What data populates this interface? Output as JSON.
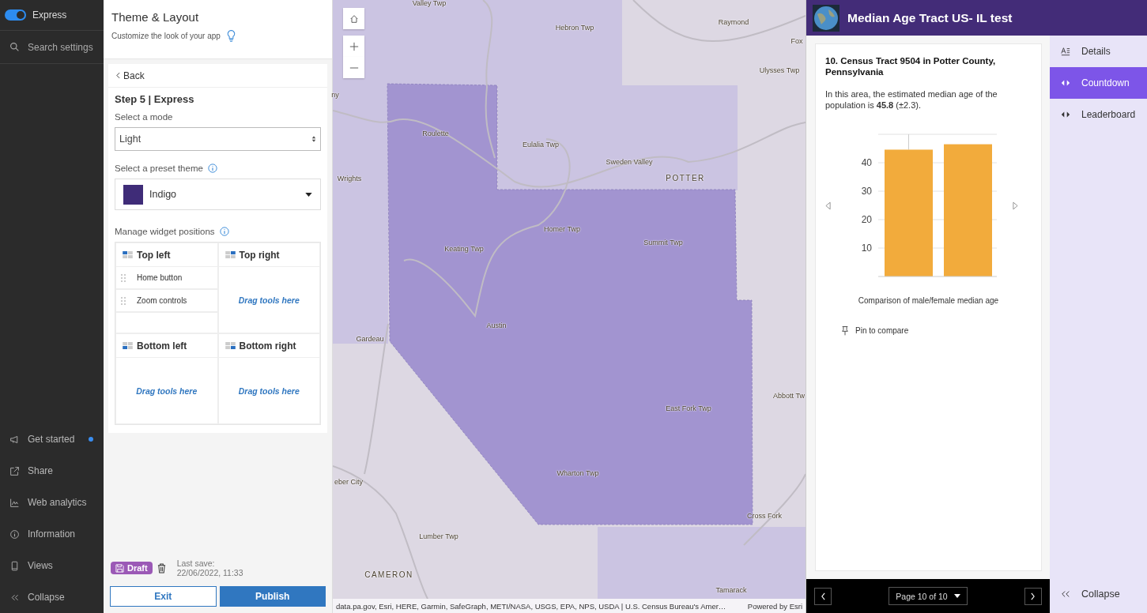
{
  "sidebar": {
    "toggle": {
      "label": "Express",
      "on": true
    },
    "search": {
      "placeholder": "Search settings"
    },
    "items": [
      {
        "kind": "megaphone",
        "label": "Get started",
        "badge": true
      },
      {
        "kind": "share",
        "label": "Share",
        "badge": false
      },
      {
        "kind": "analytics",
        "label": "Web analytics",
        "badge": false
      },
      {
        "kind": "info",
        "label": "Information",
        "badge": false
      },
      {
        "kind": "phone",
        "label": "Views",
        "badge": false
      },
      {
        "kind": "collapse",
        "label": "Collapse",
        "badge": false
      }
    ]
  },
  "panel": {
    "title": "Theme & Layout",
    "subtitle": "Customize the look of your app",
    "back": "Back",
    "step": "Step 5 | Express",
    "mode": {
      "label": "Select a mode",
      "value": "Light"
    },
    "theme": {
      "label": "Select a preset theme",
      "value": "Indigo",
      "color": "#3f2c78"
    },
    "widgets": {
      "label": "Manage widget positions",
      "quadrants": [
        {
          "title": "Top left",
          "items": [
            "Home button",
            "Zoom controls"
          ]
        },
        {
          "title": "Top right",
          "placeholder": "Drag tools here"
        },
        {
          "title": "Bottom left",
          "placeholder": "Drag tools here"
        },
        {
          "title": "Bottom right",
          "placeholder": "Drag tools here"
        }
      ]
    },
    "status": {
      "badge": "Draft",
      "label": "Last save:",
      "time": "22/06/2022, 11:33"
    },
    "buttons": {
      "exit": "Exit",
      "publish": "Publish"
    }
  },
  "map": {
    "labels": [
      "Valley Twp",
      "Hebron Twp",
      "Raymond",
      "Fox",
      "Ulysses Twp",
      "ny",
      "Roulette",
      "Eulalia Twp",
      "Sweden Valley",
      "POTTER",
      "Wrights",
      "Homer Twp",
      "Summit Twp",
      "Keating Twp",
      "Austin",
      "Gardeau",
      "Abbott Tw",
      "East Fork Twp",
      "eber City",
      "Wharton Twp",
      "Cross Fork",
      "Lumber Twp",
      "CAMERON",
      "Tamarack"
    ],
    "attribution": "data.pa.gov, Esri, HERE, Garmin, SafeGraph, METI/NASA, USGS, EPA, NPS, USDA | U.S. Census Bureau's Amer…",
    "powered": "Powered by Esri"
  },
  "app": {
    "title": "Median Age Tract US- IL test",
    "card": {
      "heading": "10. Census Tract 9504 in Potter County, Pennsylvania",
      "text": "In this area, the estimated median age of the population is **45.8** (±2.3).",
      "chart_data": {
        "type": "bar",
        "xlabel": "Comparison of male/female median age",
        "grid": true,
        "values": [
          44.6,
          46.5
        ],
        "ylim": [
          0,
          50
        ],
        "yticks": [
          10,
          20,
          30,
          40
        ]
      },
      "pin": "Pin to compare"
    },
    "pager": "Page 10 of 10",
    "nav": [
      {
        "kind": "details",
        "label": "Details",
        "selected": false
      },
      {
        "kind": "arrows",
        "label": "Countdown",
        "selected": true
      },
      {
        "kind": "arrows",
        "label": "Leaderboard",
        "selected": false
      }
    ],
    "collapse": "Collapse"
  }
}
